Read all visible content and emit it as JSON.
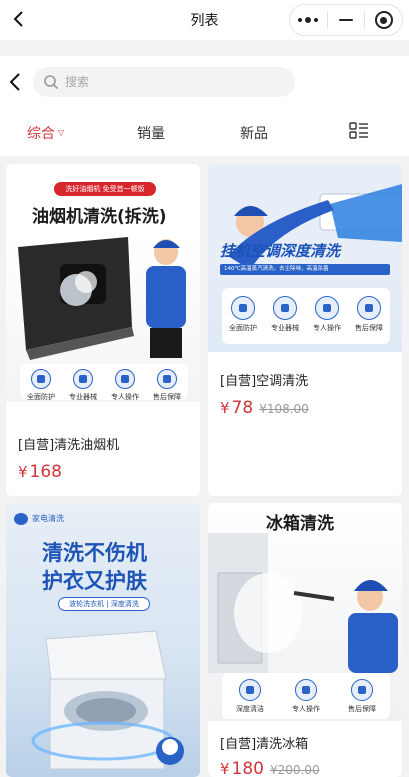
{
  "navbar": {
    "title": "列表",
    "icons": [
      "back-chevron-icon",
      "more-dots-icon",
      "minimize-icon",
      "close-target-icon"
    ]
  },
  "search": {
    "placeholder": "搜索"
  },
  "sort_tabs": [
    {
      "label": "综合",
      "active": true
    },
    {
      "label": "销量",
      "active": false
    },
    {
      "label": "新品",
      "active": false
    }
  ],
  "products": [
    {
      "image_text": {
        "badge": "洗好油烟机 免受首一顿饭",
        "title": "油烟机清洗(拆洗)",
        "badges": [
          "全面防护",
          "专业器械",
          "专人操作",
          "售后保障"
        ]
      },
      "name": "[自营]清洗油烟机",
      "currency": "¥",
      "price": "168",
      "original_price": ""
    },
    {
      "image_text": {
        "title": "挂机空调深度清洗",
        "subtitle": "140℃高温蒸汽清洗，去尘除味，高温杀菌",
        "badges": [
          "全面防护",
          "专业器械",
          "专人操作",
          "售后保障"
        ]
      },
      "name": "[自营]空调清洗",
      "currency": "¥",
      "price": "78",
      "original_price": "¥108.00"
    },
    {
      "image_text": {
        "brand": "家电清洗",
        "title_line1": "清洗不伤机",
        "title_line2": "护衣又护肤",
        "tag": "波轮洗衣机 | 深度清洗"
      },
      "name": "",
      "currency": "",
      "price": "",
      "original_price": ""
    },
    {
      "image_text": {
        "title": "冰箱清洗",
        "badges": [
          "深度清洁",
          "专人操作",
          "售后保障"
        ]
      },
      "name": "[自营]清洗冰箱",
      "currency": "¥",
      "price": "180",
      "original_price": "¥200.00"
    }
  ],
  "colors": {
    "accent": "#d0373b",
    "brand_blue": "#2a63c7"
  }
}
